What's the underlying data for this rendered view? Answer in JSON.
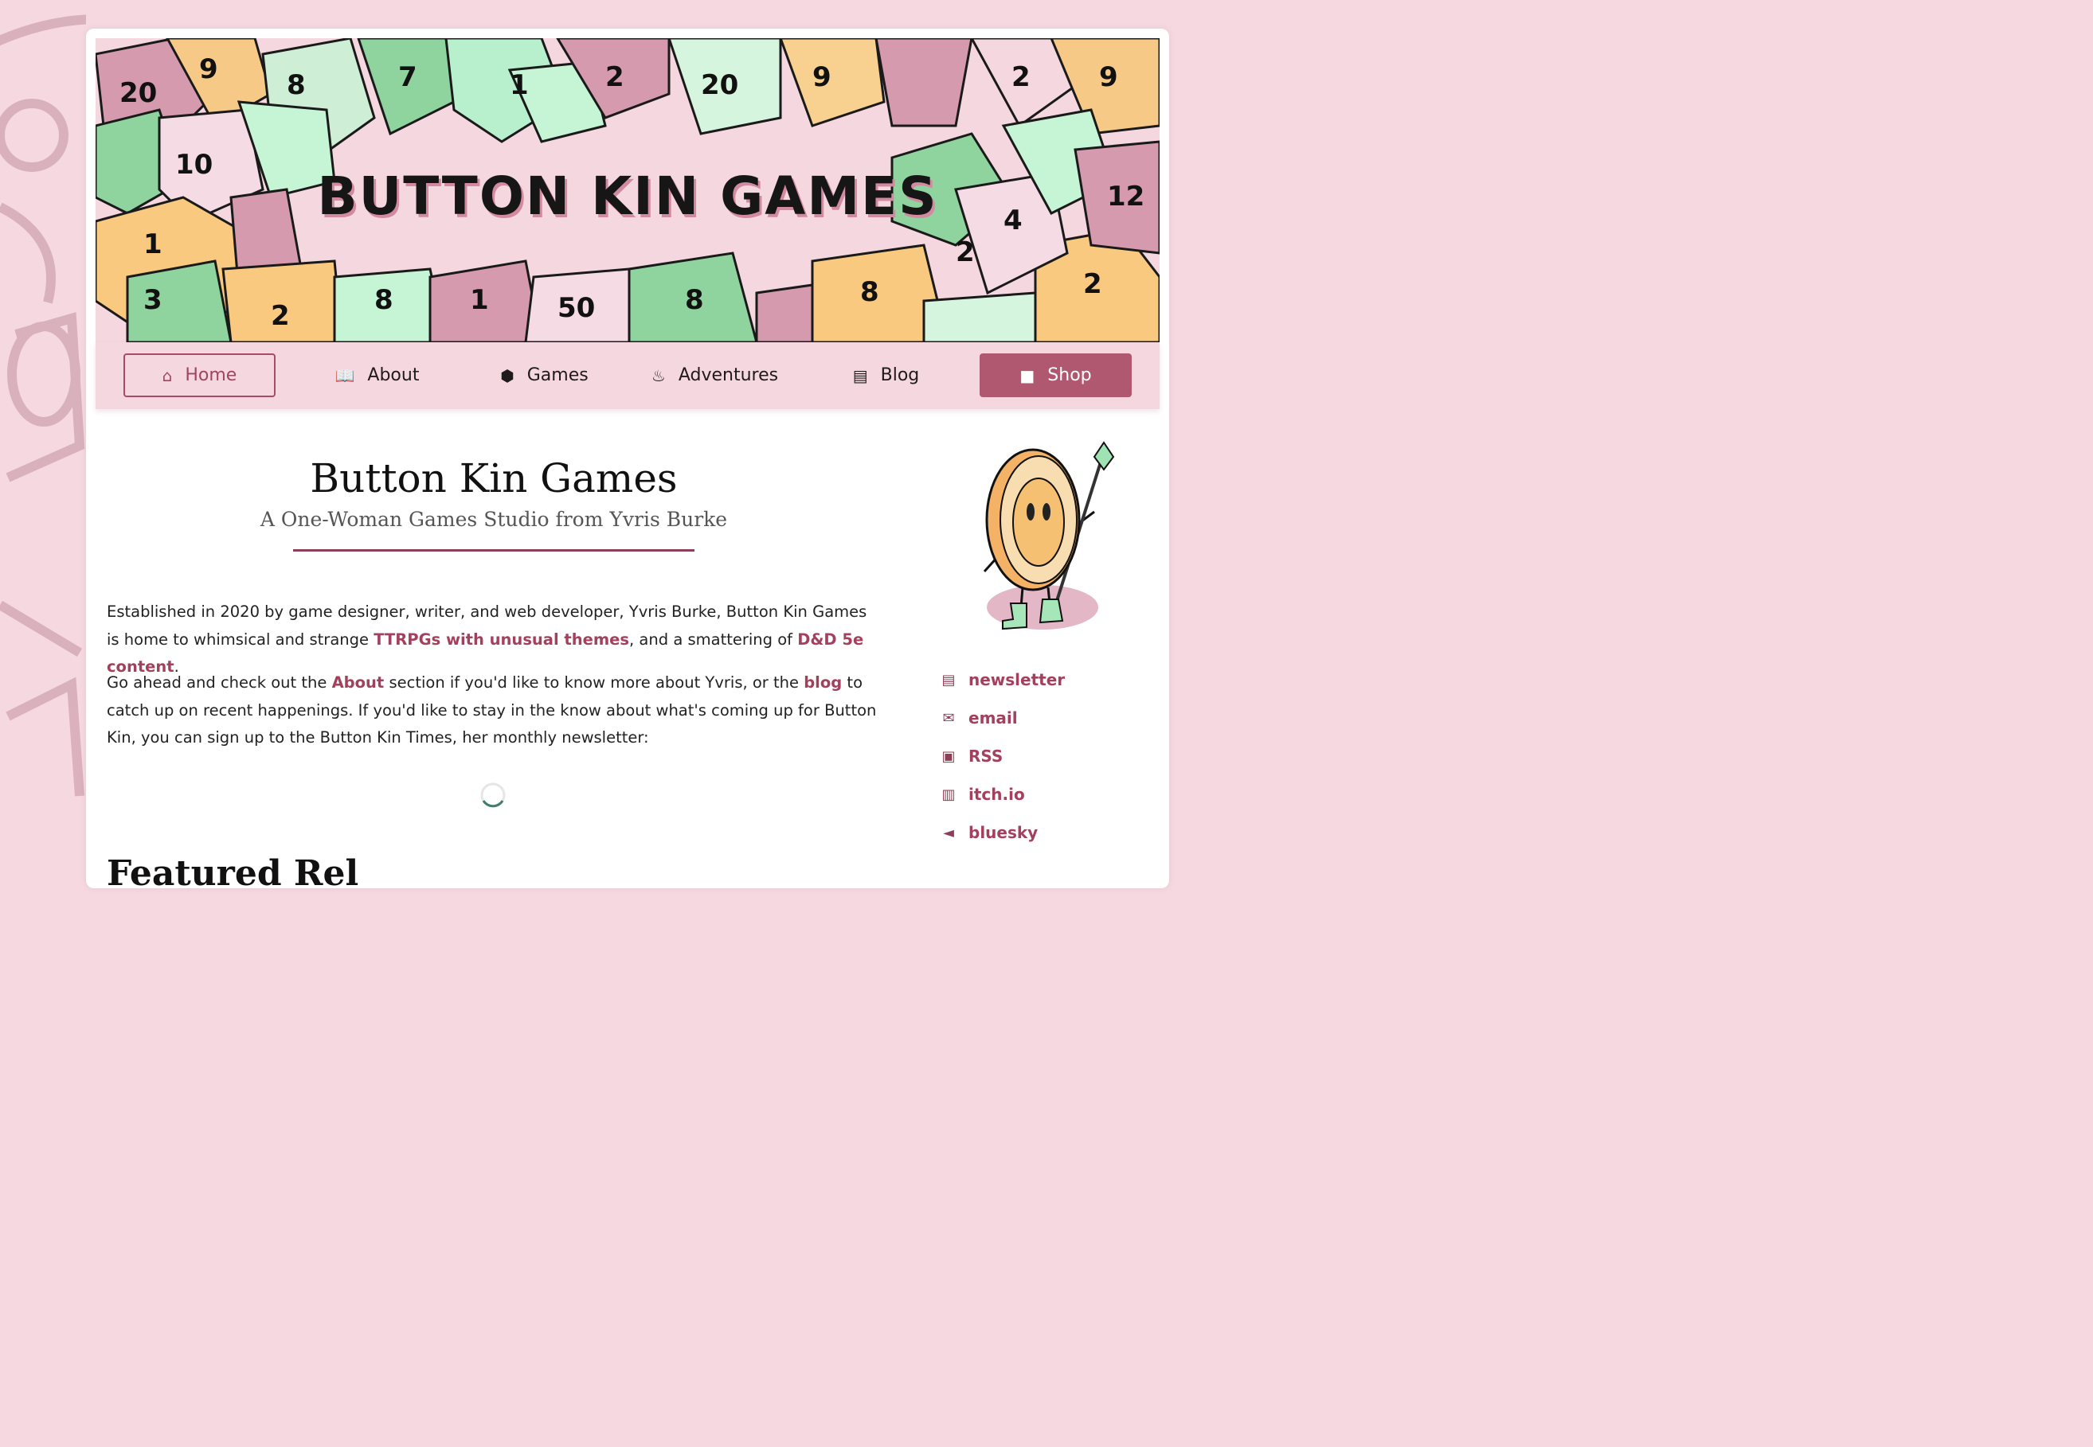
{
  "banner": {
    "title": "BUTTON KIN GAMES"
  },
  "nav": {
    "home": "Home",
    "about": "About",
    "games": "Games",
    "adventures": "Adventures",
    "blog": "Blog",
    "shop": "Shop"
  },
  "header": {
    "title": "Button Kin Games",
    "subtitle": "A One-Woman Games Studio from Yvris Burke"
  },
  "intro": {
    "p1_text1": "Established in 2020 by game designer, writer, and web developer, Yvris Burke, Button Kin Games is home to whimsical and strange ",
    "p1_link1": "TTRPGs with unusual themes",
    "p1_text2": ", and a smattering of ",
    "p1_link2": "D&D 5e content",
    "p1_text3": ".",
    "p2_text1": "Go ahead and check out the ",
    "p2_link1": "About",
    "p2_text2": " section if you'd like to know more about Yvris, or the ",
    "p2_link2": "blog",
    "p2_text3": " to catch up on recent happenings. If you'd like to stay in the know about what's coming up for Button Kin, you can sign up to the Button Kin Times, her monthly newsletter:"
  },
  "sidebar": {
    "links": [
      {
        "label": "newsletter",
        "icon": "newspaper-icon"
      },
      {
        "label": "email",
        "icon": "envelope-icon"
      },
      {
        "label": "RSS",
        "icon": "rss-icon"
      },
      {
        "label": "itch.io",
        "icon": "itchio-icon"
      },
      {
        "label": "bluesky",
        "icon": "megaphone-icon"
      }
    ]
  },
  "next_section": {
    "heading": "Featured Rel"
  },
  "colors": {
    "accent": "#a3405e",
    "page_bg": "#f5d8e0",
    "nav_bg": "#f4d7df",
    "shop_bg": "#b05870"
  }
}
